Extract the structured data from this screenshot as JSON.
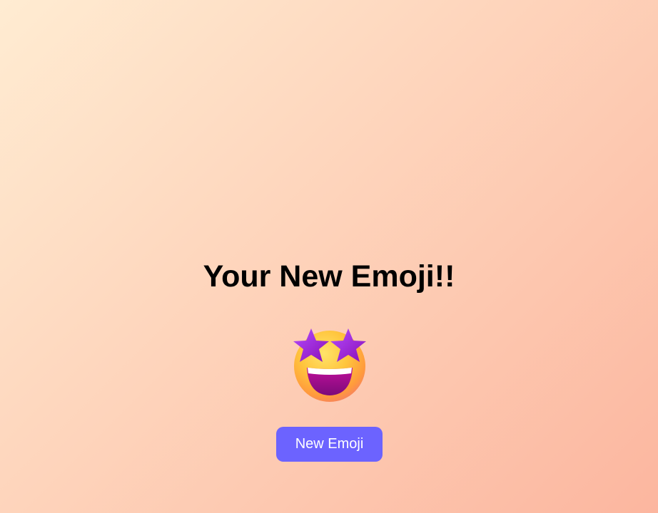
{
  "heading": "Your New Emoji!!",
  "emoji": {
    "icon": "star-struck-emoji-icon",
    "glyph": "🤩"
  },
  "button": {
    "label": "New Emoji"
  },
  "colors": {
    "background_start": "#ffecd2",
    "background_end": "#fcb69f",
    "button": "#6c63ff",
    "button_text": "#ffffff",
    "heading": "#000000"
  }
}
